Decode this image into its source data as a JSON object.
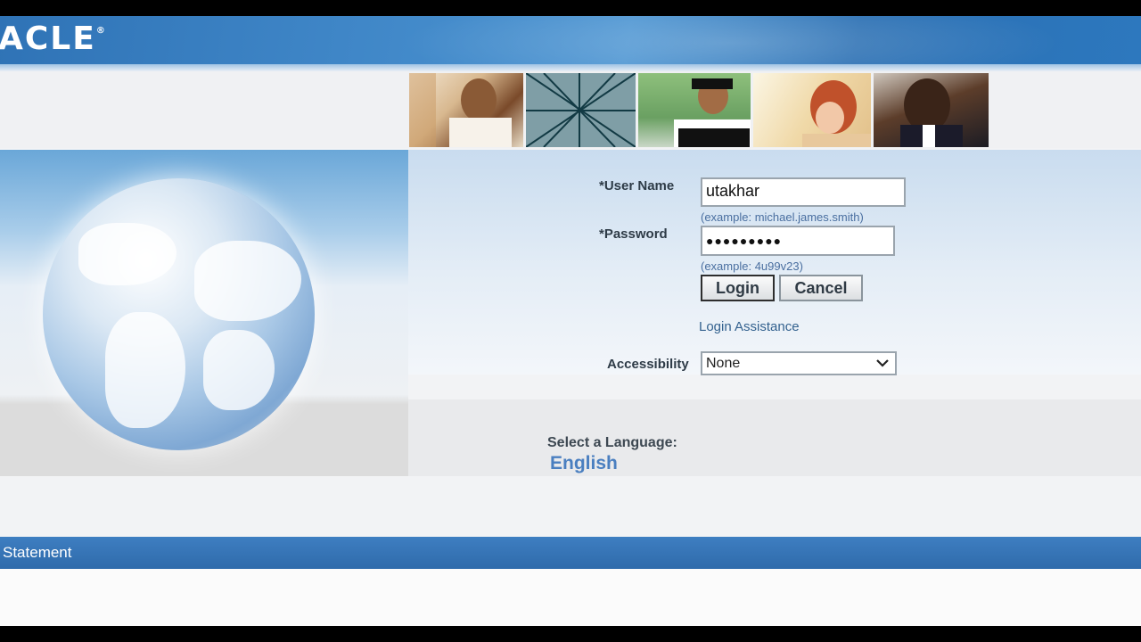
{
  "header": {
    "logo_text": "ACLE",
    "logo_mark": "®"
  },
  "photos": [
    "photo-1",
    "photo-2",
    "photo-3",
    "photo-4",
    "photo-5"
  ],
  "login": {
    "username_label": "*User Name",
    "username_value": "utakhar",
    "username_hint": "(example: michael.james.smith)",
    "password_label": "*Password",
    "password_value": "●●●●●●●●●",
    "password_hint": "(example: 4u99v23)",
    "login_button": "Login",
    "cancel_button": "Cancel",
    "assistance_link": "Login Assistance",
    "accessibility_label": "Accessibility",
    "accessibility_value": "None",
    "chevron_icon": "chevron-down-icon"
  },
  "language": {
    "title": "Select a Language:",
    "english": "English"
  },
  "footer": {
    "statement_label": "Statement"
  }
}
